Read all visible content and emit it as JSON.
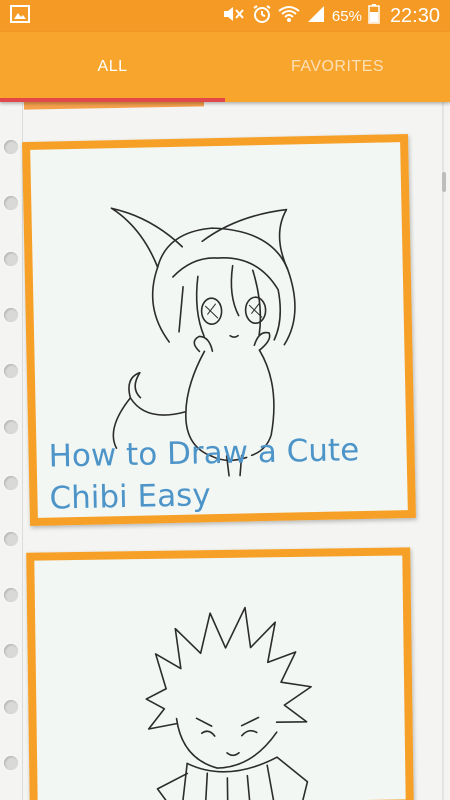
{
  "status_bar": {
    "battery_percent": "65%",
    "time": "22:30",
    "icons": [
      "gallery-icon",
      "mute-icon",
      "alarm-icon",
      "wifi-icon",
      "signal-icon",
      "battery-icon"
    ]
  },
  "tabs": [
    {
      "label": "ALL",
      "selected": true
    },
    {
      "label": "FAVORITES",
      "selected": false
    }
  ],
  "colors": {
    "status_bar": "#f49a25",
    "tab_bar": "#f7a52d",
    "tab_indicator": "#e2474a",
    "card_frame": "#f7a028",
    "title_text": "#4d94c8"
  },
  "cards": [
    {
      "title": "How to Draw a Cute Chibi Easy",
      "image": "chibi-cat-girl-sketch"
    },
    {
      "title": "",
      "image": "chibi-spiky-hair-scarf-sketch"
    }
  ]
}
